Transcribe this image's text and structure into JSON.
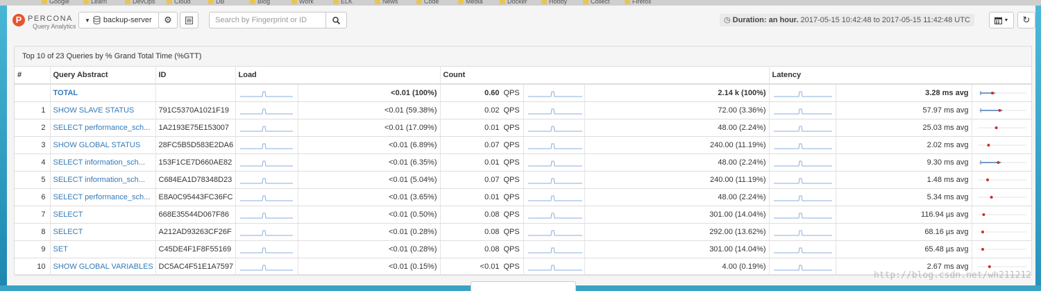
{
  "bookmarks": [
    "Google",
    "Learn",
    "DevOps",
    "Cloud",
    "DB",
    "Blog",
    "Work",
    "ELK",
    "News",
    "Code",
    "Media",
    "Docker",
    "Hobby",
    "Collect",
    "Firefox"
  ],
  "header": {
    "logo_letter": "P",
    "logo_name": "PERCONA",
    "logo_sub": "Query Analytics",
    "server_label": "backup-server",
    "search_placeholder": "Search by Fingerprint or ID",
    "duration_label": "Duration: an hour.",
    "duration_range": "2017-05-15 10:42:48 to 2017-05-15 11:42:48 UTC"
  },
  "icons": {
    "server": "database-icon",
    "gear": "gear-icon",
    "list": "list-icon",
    "search": "search-icon",
    "calendar": "calendar-icon",
    "refresh": "refresh-icon"
  },
  "colors": {
    "link": "#337ab7",
    "sparkline": "#8aaee0",
    "latency_marker": "#c9302c",
    "logo": "#e8542f"
  },
  "panel": {
    "title": "Top 10 of 23 Queries by % Grand Total Time (%GTT)",
    "columns": {
      "rank": "#",
      "abstract": "Query Abstract",
      "id": "ID",
      "load": "Load",
      "count": "Count",
      "latency": "Latency"
    },
    "qps_unit": "QPS",
    "total": {
      "label": "TOTAL",
      "load": "<0.01 (100%)",
      "qps": "0.60",
      "count": "2.14 k (100%)",
      "latency": "3.28 ms avg",
      "latency_pos": 0.3
    },
    "rows": [
      {
        "rank": "1",
        "abstract": "SHOW SLAVE STATUS",
        "id": "791C5370A1021F19",
        "load": "<0.01 (59.38%)",
        "qps": "0.02",
        "count": "72.00 (3.36%)",
        "latency": "57.97 ms avg",
        "latency_pos": 0.45,
        "range": true
      },
      {
        "rank": "2",
        "abstract": "SELECT performance_sch...",
        "id": "1A2193E75E153007",
        "load": "<0.01 (17.09%)",
        "qps": "0.01",
        "count": "48.00 (2.24%)",
        "latency": "25.03 ms avg",
        "latency_pos": 0.38,
        "range": false
      },
      {
        "rank": "3",
        "abstract": "SHOW GLOBAL STATUS",
        "id": "28FC5B5D583E2DA6",
        "load": "<0.01 (6.89%)",
        "qps": "0.07",
        "count": "240.00 (11.19%)",
        "latency": "2.02 ms avg",
        "latency_pos": 0.22,
        "range": false
      },
      {
        "rank": "4",
        "abstract": "SELECT information_sch...",
        "id": "153F1CE7D660AE82",
        "load": "<0.01 (6.35%)",
        "qps": "0.01",
        "count": "48.00 (2.24%)",
        "latency": "9.30 ms avg",
        "latency_pos": 0.42,
        "range": true
      },
      {
        "rank": "5",
        "abstract": "SELECT information_sch...",
        "id": "C684EA1D78348D23",
        "load": "<0.01 (5.04%)",
        "qps": "0.07",
        "count": "240.00 (11.19%)",
        "latency": "1.48 ms avg",
        "latency_pos": 0.2,
        "range": false
      },
      {
        "rank": "6",
        "abstract": "SELECT performance_sch...",
        "id": "E8A0C95443FC36FC",
        "load": "<0.01 (3.65%)",
        "qps": "0.01",
        "count": "48.00 (2.24%)",
        "latency": "5.34 ms avg",
        "latency_pos": 0.28,
        "range": false
      },
      {
        "rank": "7",
        "abstract": "SELECT",
        "id": "668E35544D067F86",
        "load": "<0.01 (0.50%)",
        "qps": "0.08",
        "count": "301.00 (14.04%)",
        "latency": "116.94 µs avg",
        "latency_pos": 0.12,
        "range": false
      },
      {
        "rank": "8",
        "abstract": "SELECT",
        "id": "A212AD93263CF26F",
        "load": "<0.01 (0.28%)",
        "qps": "0.08",
        "count": "292.00 (13.62%)",
        "latency": "68.16 µs avg",
        "latency_pos": 0.1,
        "range": false
      },
      {
        "rank": "9",
        "abstract": "SET",
        "id": "C45DE4F1F8F55169",
        "load": "<0.01 (0.28%)",
        "qps": "0.08",
        "count": "301.00 (14.04%)",
        "latency": "65.48 µs avg",
        "latency_pos": 0.1,
        "range": false
      },
      {
        "rank": "10",
        "abstract": "SHOW GLOBAL VARIABLES",
        "id": "DC5AC4F51E1A7597",
        "load": "<0.01 (0.15%)",
        "qps": "<0.01",
        "count": "4.00 (0.19%)",
        "latency": "2.67 ms avg",
        "latency_pos": 0.24,
        "range": false
      }
    ]
  },
  "watermark": "http://blog.csdn.net/wh211212"
}
